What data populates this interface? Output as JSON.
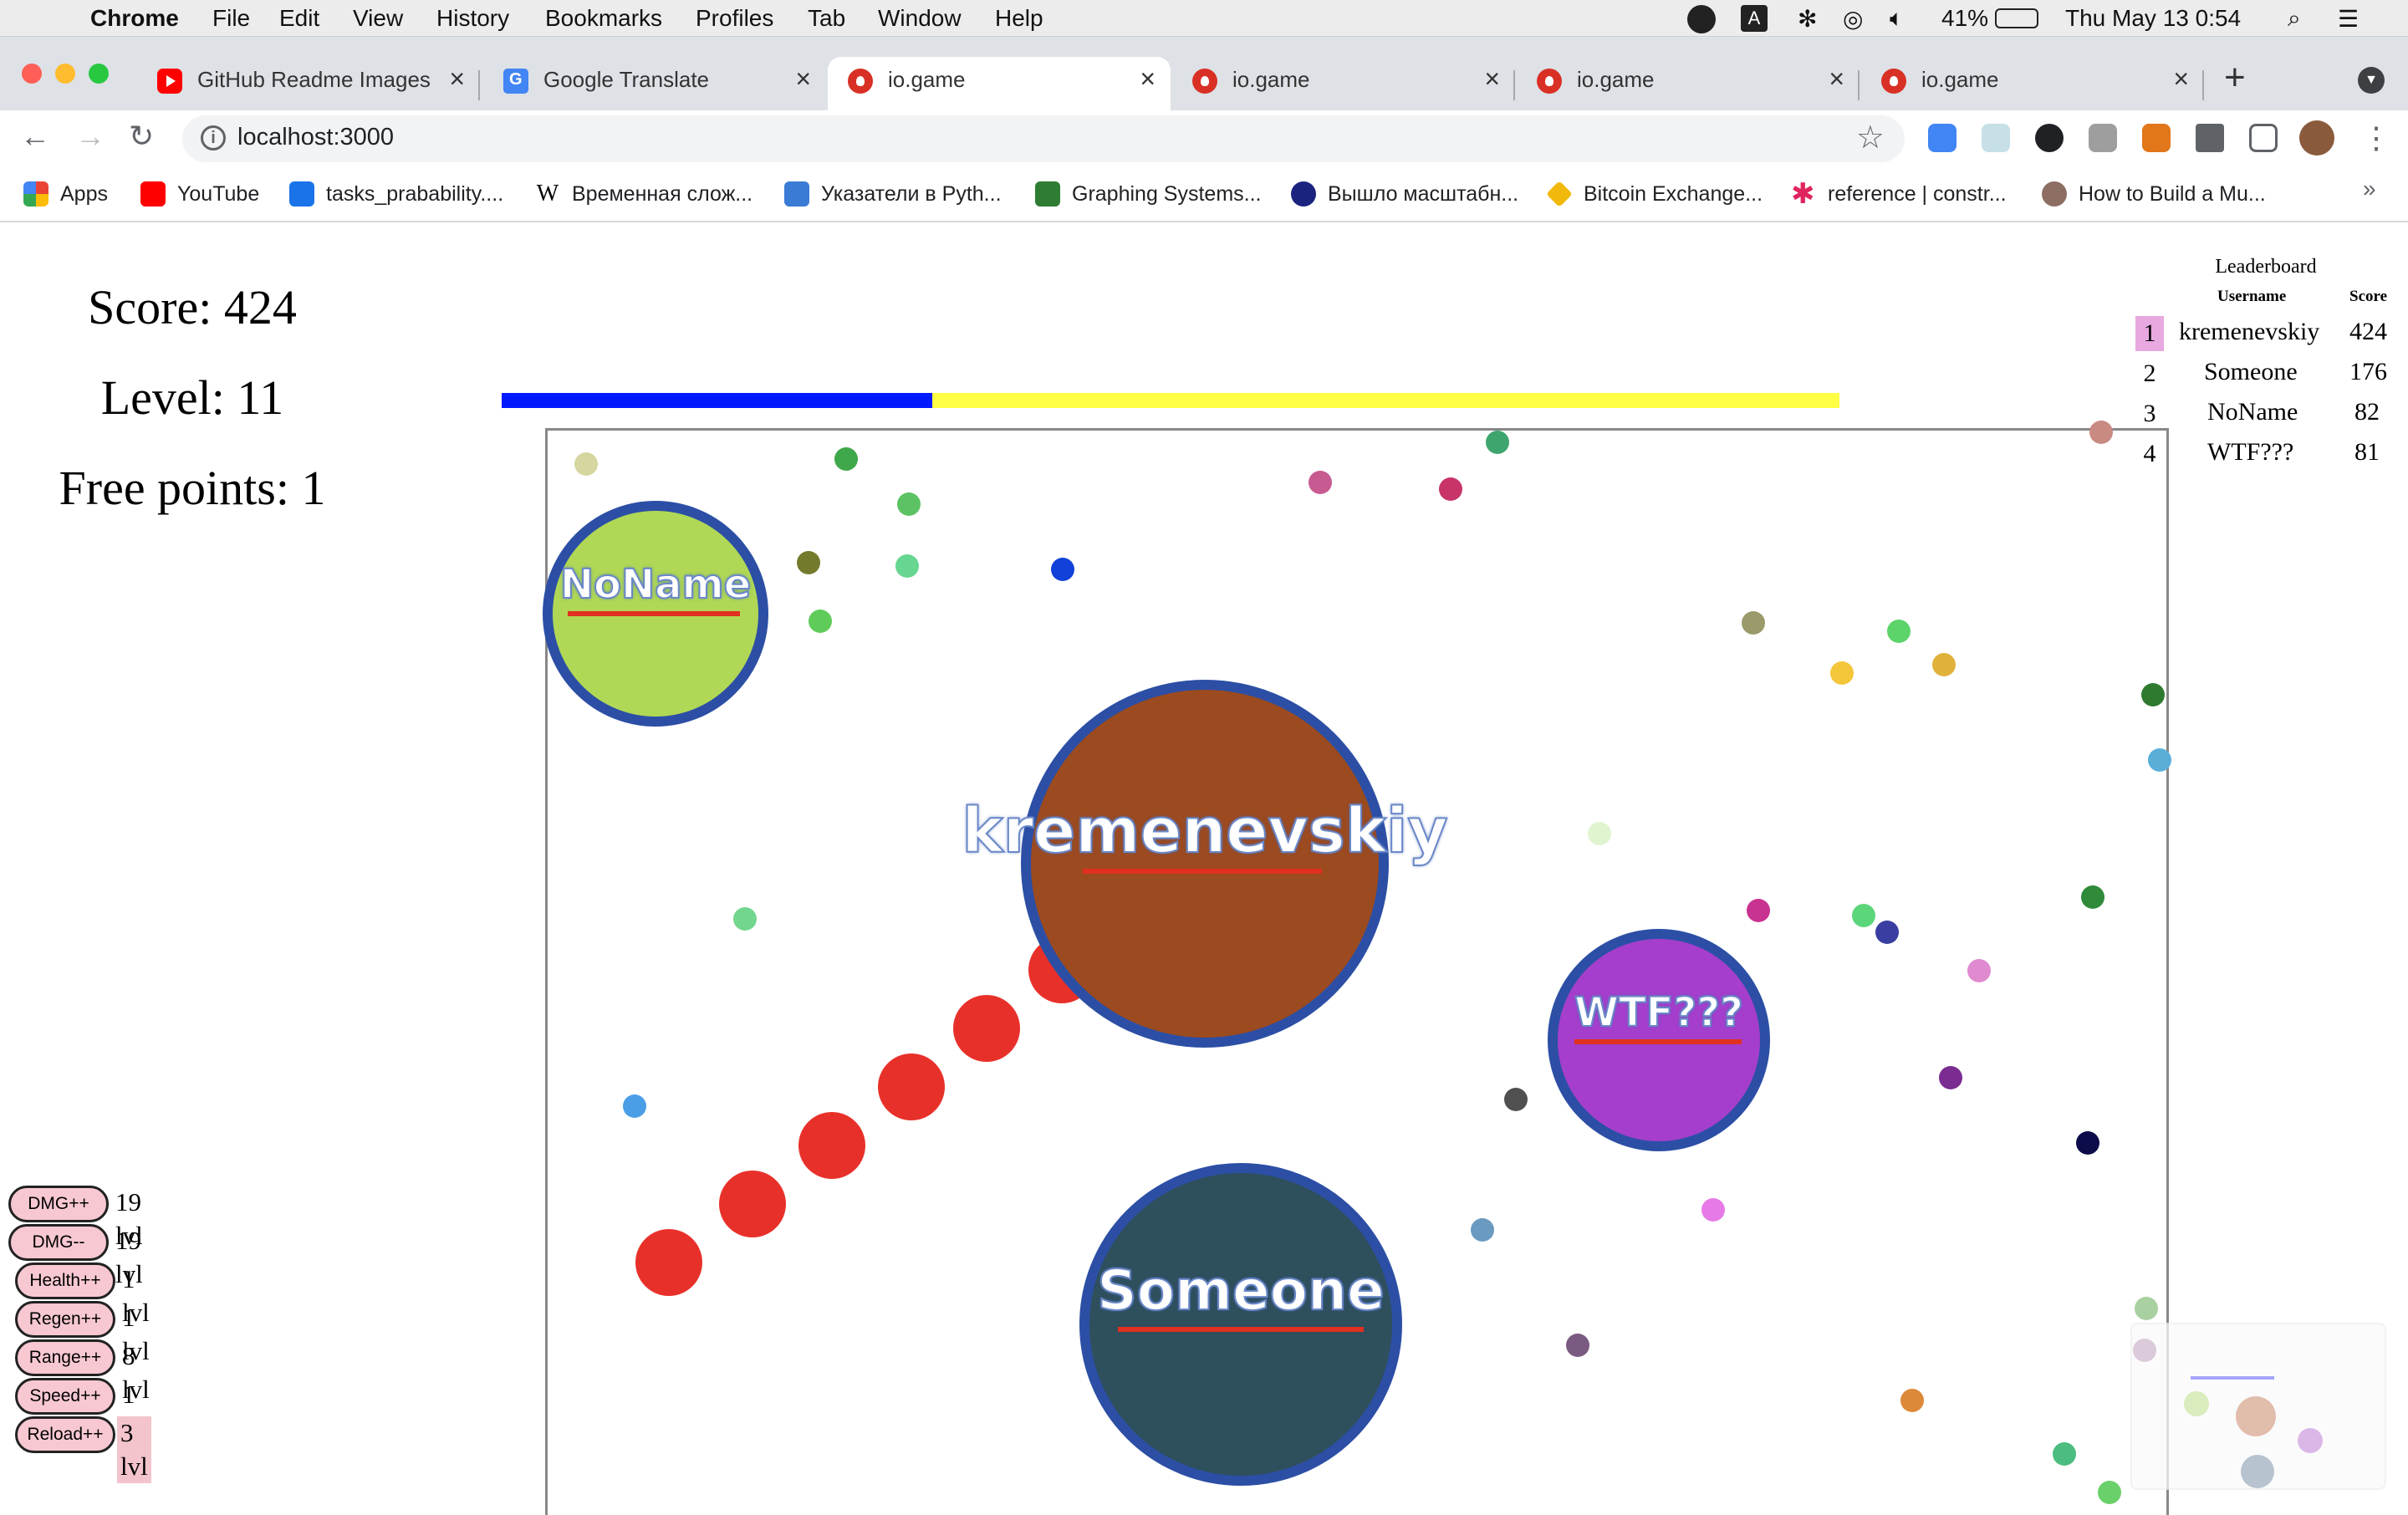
{
  "menubar": {
    "app": "Chrome",
    "items": [
      "File",
      "Edit",
      "View",
      "History",
      "Bookmarks",
      "Profiles",
      "Tab",
      "Window",
      "Help"
    ],
    "battery": "41%",
    "clock": "Thu May 13  0:54"
  },
  "tabs": [
    {
      "title": "GitHub Readme Images T",
      "favicon": "youtube-icon",
      "active": false
    },
    {
      "title": "Google Translate",
      "favicon": "google-translate-icon",
      "active": false
    },
    {
      "title": "io.game",
      "favicon": "io-game-icon",
      "active": true
    },
    {
      "title": "io.game",
      "favicon": "io-game-icon",
      "active": false
    },
    {
      "title": "io.game",
      "favicon": "io-game-icon",
      "active": false
    },
    {
      "title": "io.game",
      "favicon": "io-game-icon",
      "active": false
    }
  ],
  "toolbar": {
    "url": "localhost:3000",
    "new_tab": "+"
  },
  "bookmarks": [
    {
      "label": "Apps",
      "color": "#ea4335"
    },
    {
      "label": "YouTube",
      "color": "#ff0000"
    },
    {
      "label": "tasks_prabability....",
      "color": "#1a73e8"
    },
    {
      "label": "Временная слож...",
      "color": "#000000"
    },
    {
      "label": "Указатели в Pyth...",
      "color": "#3a7bd5"
    },
    {
      "label": "Graphing Systems...",
      "color": "#2e7d32"
    },
    {
      "label": "Вышло масштабн...",
      "color": "#1a237e"
    },
    {
      "label": "Bitcoin Exchange...",
      "color": "#f0b90b"
    },
    {
      "label": "reference | constr...",
      "color": "#e0245e"
    },
    {
      "label": "How to Build a Mu...",
      "color": "#8d6e63"
    }
  ],
  "bookmarks_more": "»",
  "hud": {
    "score": "Score: 424",
    "level": "Level: 11",
    "free_points": "Free points: 1"
  },
  "xp_progress": 0.322,
  "leaderboard": {
    "title": "Leaderboard",
    "col_user": "Username",
    "col_score": "Score",
    "rows": [
      {
        "rank": "1",
        "user": "kremenevskiy",
        "score": "424"
      },
      {
        "rank": "2",
        "user": "Someone",
        "score": "176"
      },
      {
        "rank": "3",
        "user": "NoName",
        "score": "82"
      },
      {
        "rank": "4",
        "user": "WTF???",
        "score": "81"
      }
    ]
  },
  "players": [
    {
      "name": "NoName",
      "color": "#b0d856"
    },
    {
      "name": "kremenevskiy",
      "color": "#9c4a1f"
    },
    {
      "name": "WTF???",
      "color": "#a53ecc"
    },
    {
      "name": "Someone",
      "color": "#2e4f5c"
    }
  ],
  "upgrades": [
    {
      "label": "DMG++",
      "level": "19 lvl"
    },
    {
      "label": "DMG--",
      "level": "19 lvl"
    },
    {
      "label": "Health++",
      "level": "1 lvl"
    },
    {
      "label": "Regen++",
      "level": "1 lvl"
    },
    {
      "label": "Range++",
      "level": "8 lvl"
    },
    {
      "label": "Speed++",
      "level": "1 lvl"
    },
    {
      "label": "Reload++",
      "level": "3 lvl"
    }
  ],
  "colors": {
    "xp_fill": "#0019ff",
    "xp_track": "#ffff44",
    "bullet": "#e8302a",
    "player_ring": "#2c4fa5"
  }
}
